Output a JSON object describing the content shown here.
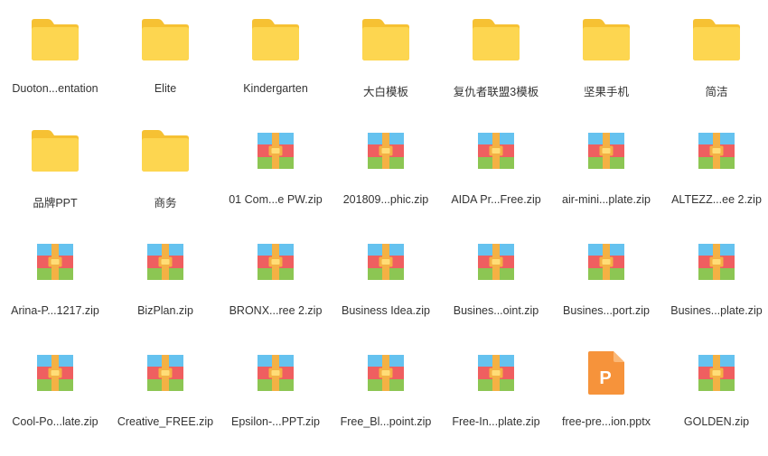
{
  "colors": {
    "folder_back": "#f6c133",
    "folder_front": "#fdd650",
    "zip_blue": "#65c2ef",
    "zip_red": "#ef5f60",
    "zip_green": "#8cc653",
    "zip_strap": "#f4b144",
    "zip_clasp": "#ffdd77",
    "pptx_body": "#f6933b",
    "pptx_fold": "#fbb877",
    "label_text": "#333333"
  },
  "files": [
    {
      "label": "Duoton...entation",
      "icon": "folder-icon"
    },
    {
      "label": "Elite",
      "icon": "folder-icon"
    },
    {
      "label": "Kindergarten",
      "icon": "folder-icon"
    },
    {
      "label": "大白模板",
      "icon": "folder-icon"
    },
    {
      "label": "复仇者联盟3模板",
      "icon": "folder-icon"
    },
    {
      "label": "坚果手机",
      "icon": "folder-icon"
    },
    {
      "label": "简洁",
      "icon": "folder-icon"
    },
    {
      "label": "品牌PPT",
      "icon": "folder-icon"
    },
    {
      "label": "商务",
      "icon": "folder-icon"
    },
    {
      "label": "01 Com...e PW.zip",
      "icon": "zip-archive-icon"
    },
    {
      "label": "201809...phic.zip",
      "icon": "zip-archive-icon"
    },
    {
      "label": "AIDA Pr...Free.zip",
      "icon": "zip-archive-icon"
    },
    {
      "label": "air-mini...plate.zip",
      "icon": "zip-archive-icon"
    },
    {
      "label": "ALTEZZ...ee 2.zip",
      "icon": "zip-archive-icon"
    },
    {
      "label": "Arina-P...1217.zip",
      "icon": "zip-archive-icon"
    },
    {
      "label": "BizPlan.zip",
      "icon": "zip-archive-icon"
    },
    {
      "label": "BRONX...ree 2.zip",
      "icon": "zip-archive-icon"
    },
    {
      "label": "Business Idea.zip",
      "icon": "zip-archive-icon"
    },
    {
      "label": "Busines...oint.zip",
      "icon": "zip-archive-icon"
    },
    {
      "label": "Busines...port.zip",
      "icon": "zip-archive-icon"
    },
    {
      "label": "Busines...plate.zip",
      "icon": "zip-archive-icon"
    },
    {
      "label": "Cool-Po...late.zip",
      "icon": "zip-archive-icon"
    },
    {
      "label": "Creative_FREE.zip",
      "icon": "zip-archive-icon"
    },
    {
      "label": "Epsilon-...PPT.zip",
      "icon": "zip-archive-icon"
    },
    {
      "label": "Free_Bl...point.zip",
      "icon": "zip-archive-icon"
    },
    {
      "label": "Free-In...plate.zip",
      "icon": "zip-archive-icon"
    },
    {
      "label": "free-pre...ion.pptx",
      "icon": "pptx-icon",
      "glyph": "P"
    },
    {
      "label": "GOLDEN.zip",
      "icon": "zip-archive-icon"
    }
  ]
}
